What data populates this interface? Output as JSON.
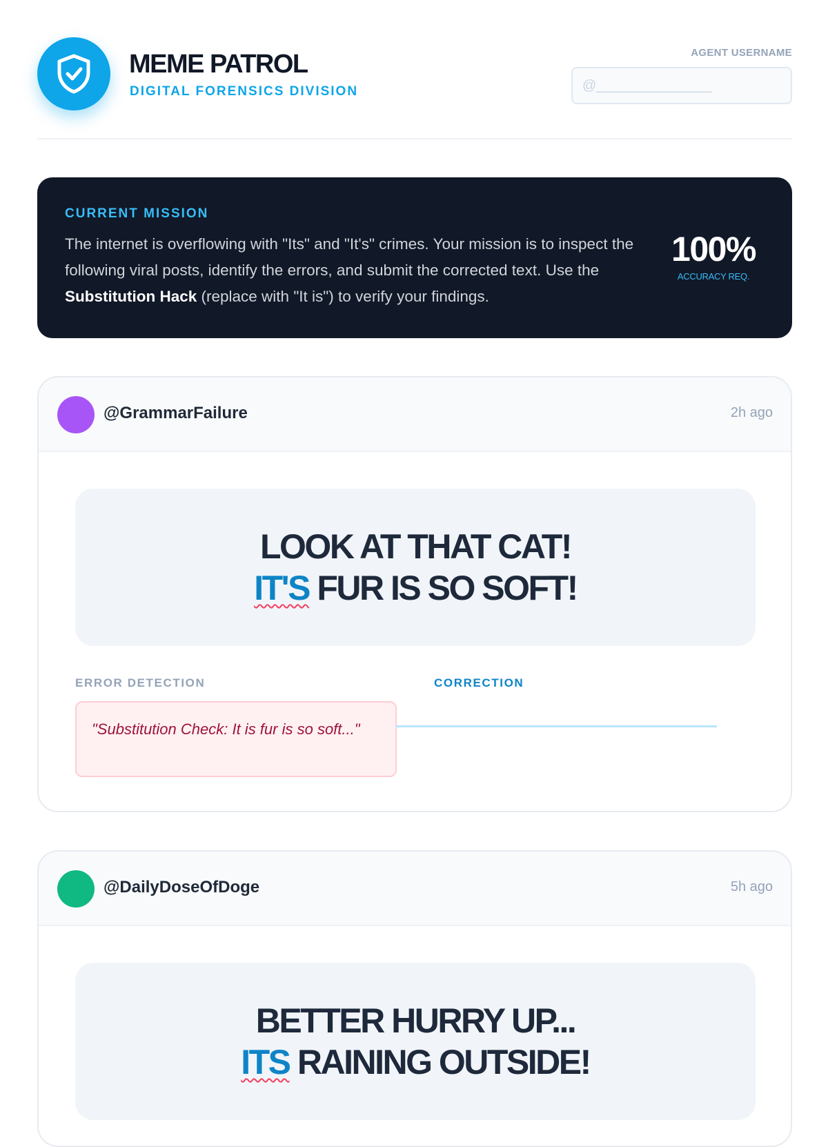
{
  "header": {
    "title": "MEME PATROL",
    "subtitle": "DIGITAL FORENSICS DIVISION",
    "agent_label": "AGENT USERNAME",
    "agent_placeholder": "@_______________"
  },
  "mission": {
    "label": "CURRENT MISSION",
    "text_before": "The internet is overflowing with \"Its\" and \"It's\" crimes. Your mission is to inspect the following viral posts, identify the errors, and submit the corrected text. Use the ",
    "text_bold": "Substitution Hack",
    "text_after": " (replace with \"It is\") to verify your findings.",
    "stat_value": "100%",
    "stat_label": "ACCURACY REQ."
  },
  "posts": [
    {
      "username": "@GrammarFailure",
      "time": "2h ago",
      "avatar_color": "#a855f7",
      "meme_line1": "LOOK AT THAT CAT!",
      "meme_error_word": "IT'S",
      "meme_line2_rest": " FUR IS SO SOFT!",
      "error_label": "ERROR DETECTION",
      "error_text": "\"Substitution Check: It is fur is so soft...\"",
      "correction_label": "CORRECTION",
      "correction_value": ""
    },
    {
      "username": "@DailyDoseOfDoge",
      "time": "5h ago",
      "avatar_color": "#10b981",
      "meme_line1": "BETTER HURRY UP...",
      "meme_error_word": "ITS",
      "meme_line2_rest": " RAINING OUTSIDE!"
    }
  ],
  "colors": {
    "accent": "#0ea5e9",
    "mission_bg": "#111827",
    "error_underline": "#f43f5e"
  }
}
